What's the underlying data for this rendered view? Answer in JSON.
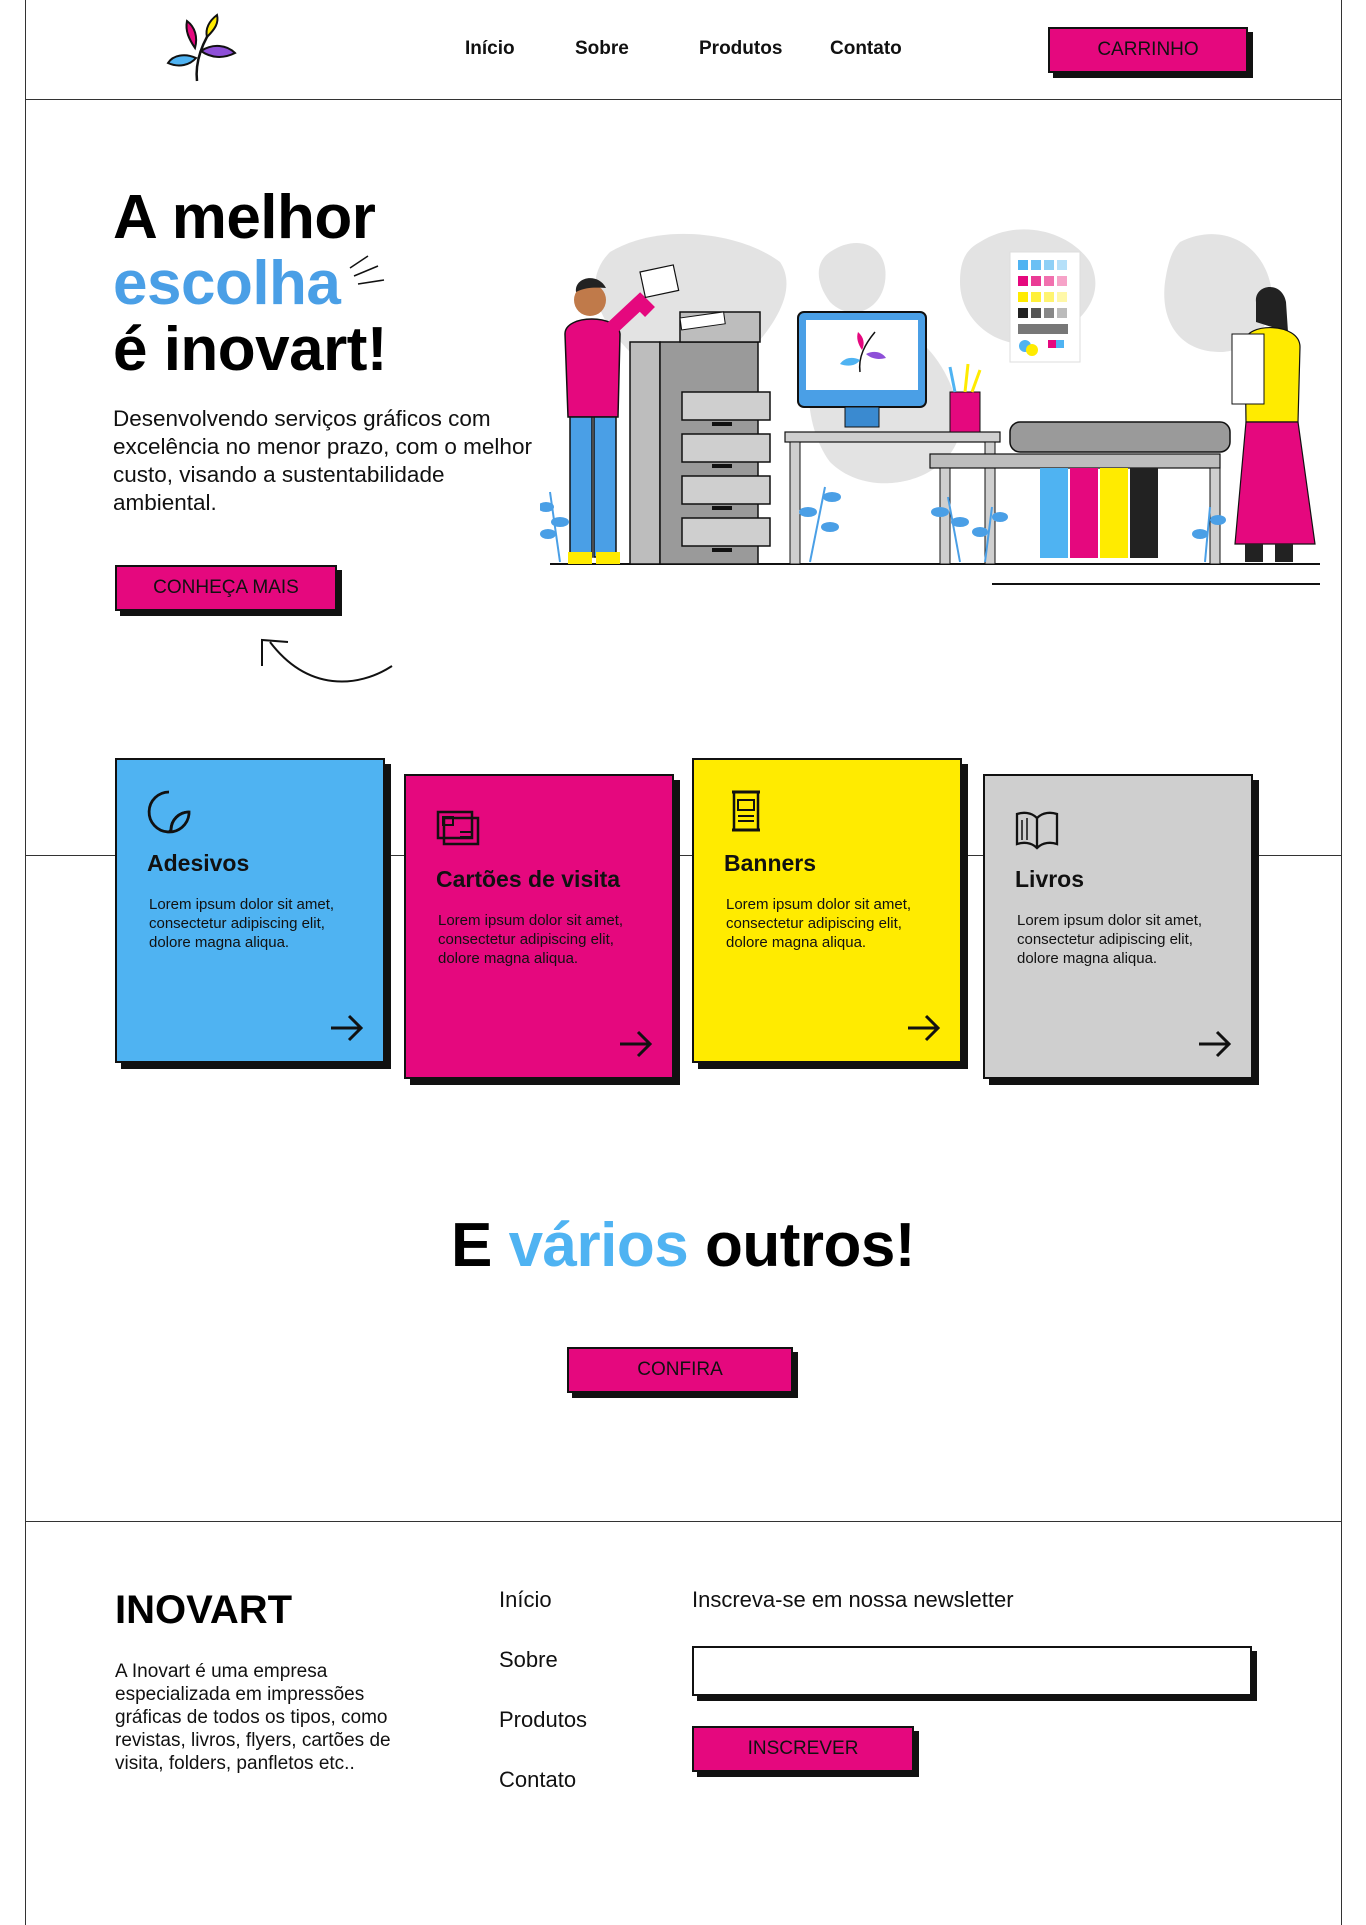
{
  "header": {
    "nav": [
      "Início",
      "Sobre",
      "Produtos",
      "Contato"
    ],
    "cart_label": "CARRINHO"
  },
  "hero": {
    "title_line1": "A melhor",
    "title_line2": "escolha",
    "title_line3": "é inovart!",
    "description": "Desenvolvendo serviços gráficos com excelência no menor prazo, com o melhor custo, visando a sustentabilidade ambiental.",
    "cta_label": "CONHEÇA MAIS"
  },
  "colors": {
    "magenta": "#e5087e",
    "cyan": "#4fb3f2",
    "blue_text": "#4a9fe6",
    "yellow": "#ffeb00",
    "gray": "#cfcfcf",
    "black": "#111111"
  },
  "products": [
    {
      "title": "Adesivos",
      "text": "Lorem ipsum dolor sit amet, consectetur adipiscing elit, dolore magna aliqua.",
      "icon": "sticker-icon",
      "color": "#4fb3f2"
    },
    {
      "title": "Cartões de visita",
      "text": "Lorem ipsum dolor sit amet, consectetur adipiscing elit, dolore magna aliqua.",
      "icon": "business-card-icon",
      "color": "#e5087e"
    },
    {
      "title": "Banners",
      "text": "Lorem ipsum dolor sit amet, consectetur adipiscing elit, dolore magna aliqua.",
      "icon": "banner-icon",
      "color": "#ffeb00"
    },
    {
      "title": "Livros",
      "text": "Lorem ipsum dolor sit amet, consectetur adipiscing elit, dolore magna aliqua.",
      "icon": "book-icon",
      "color": "#cfcfcf"
    }
  ],
  "others": {
    "word1": "E",
    "word2": "vários",
    "word3": "outros!",
    "cta_label": "CONFIRA"
  },
  "footer": {
    "brand": "INOVART",
    "description": "A Inovart é uma empresa especializada em impressões gráficas de todos os tipos, como revistas, livros, flyers, cartões de visita, folders, panfletos etc..",
    "links": [
      "Início",
      "Sobre",
      "Produtos",
      "Contato"
    ],
    "newsletter_label": "Inscreva-se em nossa newsletter",
    "newsletter_value": "",
    "subscribe_label": "INSCREVER"
  }
}
